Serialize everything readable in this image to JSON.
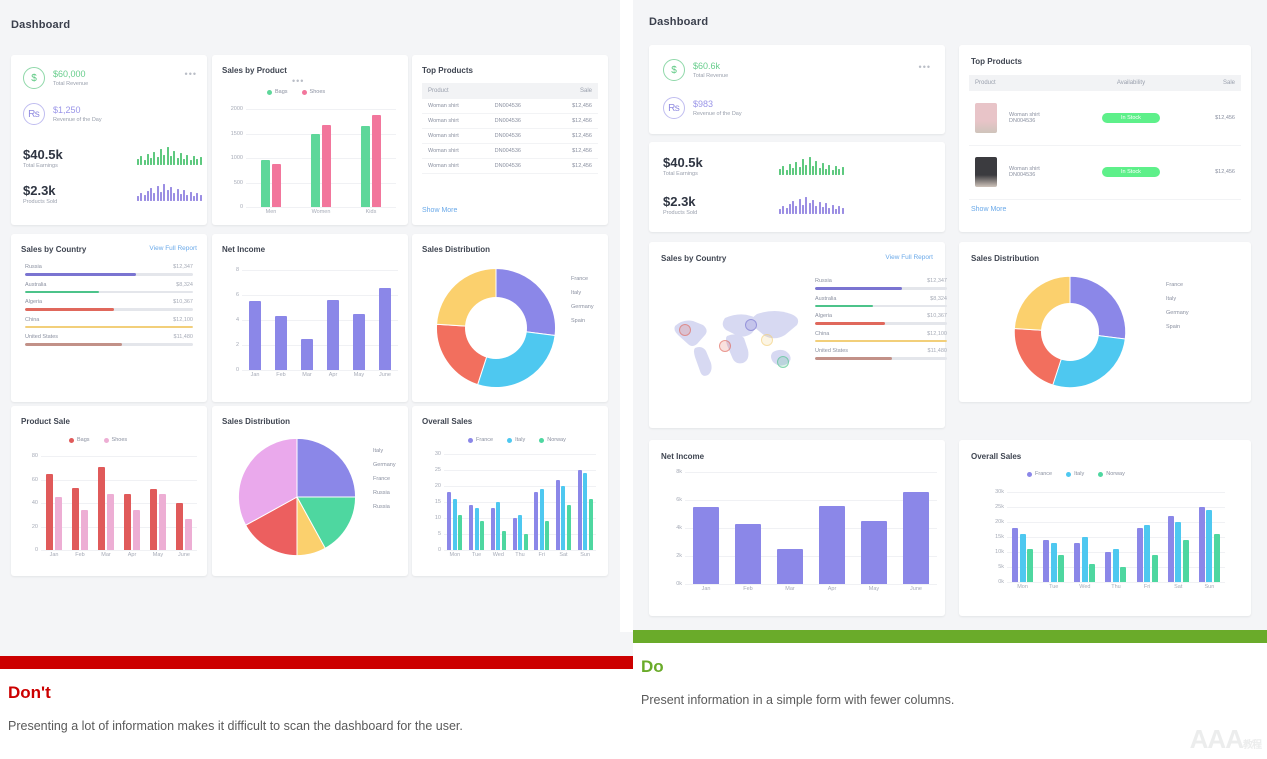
{
  "left": {
    "page_title": "Dashboard",
    "kpi": {
      "revenue_value": "$60,000",
      "revenue_label": "Total Revenue",
      "revenue_icon": "dollar-circle-icon",
      "day_value": "$1,250",
      "day_label": "Revenue of the Day",
      "day_icon": "rupee-circle-icon",
      "menu": "•••",
      "earnings_value": "$40.5k",
      "earnings_label": "Total Earnings",
      "sold_value": "$2.3k",
      "sold_label": "Products Sold",
      "earnings_spark": [
        6,
        9,
        5,
        11,
        7,
        13,
        8,
        16,
        10,
        18,
        9,
        14,
        7,
        12,
        6,
        10,
        5,
        9,
        6,
        8
      ],
      "sold_spark": [
        5,
        8,
        6,
        10,
        13,
        8,
        15,
        9,
        17,
        11,
        14,
        8,
        12,
        7,
        11,
        6,
        9,
        5,
        8,
        6
      ]
    },
    "sales_by_product": {
      "title": "Sales by Product",
      "menu": "•••",
      "legend": [
        {
          "label": "Bags",
          "color": "#5ed79a"
        },
        {
          "label": "Shoes",
          "color": "#f2769c"
        }
      ]
    },
    "top_products": {
      "title": "Top Products",
      "columns": [
        "Product",
        "Sale"
      ],
      "rows": [
        {
          "name": "Woman shirt",
          "sku": "DN004536",
          "sale": "$12,456"
        },
        {
          "name": "Woman shirt",
          "sku": "DN004536",
          "sale": "$12,456"
        },
        {
          "name": "Woman shirt",
          "sku": "DN004536",
          "sale": "$12,456"
        },
        {
          "name": "Woman shirt",
          "sku": "DN004536",
          "sale": "$12,456"
        },
        {
          "name": "Woman shirt",
          "sku": "DN004536",
          "sale": "$12,456"
        }
      ],
      "show_more": "Show More"
    },
    "sales_by_country": {
      "title": "Sales by Country",
      "action": "View Full Report"
    },
    "net_income": {
      "title": "Net Income"
    },
    "sales_distribution_donut": {
      "title": "Sales Distribution"
    },
    "product_sale": {
      "title": "Product Sale",
      "legend": [
        {
          "label": "Bags",
          "color": "#e05a5a"
        },
        {
          "label": "Shoes",
          "color": "#edaed4"
        }
      ]
    },
    "sales_distribution_pie": {
      "title": "Sales Distribution"
    },
    "overall_sales": {
      "title": "Overall Sales"
    }
  },
  "right": {
    "page_title": "Dashboard",
    "kpi": {
      "revenue_value": "$60.6k",
      "revenue_label": "Total Revenue",
      "revenue_icon": "dollar-circle-icon",
      "day_value": "$983",
      "day_label": "Revenue of the Day",
      "day_icon": "rupee-circle-icon",
      "menu": "•••",
      "earnings_value": "$40.5k",
      "earnings_label": "Total Earnings",
      "sold_value": "$2.3k",
      "sold_label": "Products Sold",
      "earnings_spark": [
        6,
        9,
        5,
        11,
        7,
        13,
        8,
        16,
        10,
        18,
        9,
        14,
        7,
        12,
        6,
        10,
        5,
        9,
        6,
        8
      ],
      "sold_spark": [
        5,
        8,
        6,
        10,
        13,
        8,
        15,
        9,
        17,
        11,
        14,
        8,
        12,
        7,
        11,
        6,
        9,
        5,
        8,
        6
      ]
    },
    "top_products": {
      "title": "Top Products",
      "columns": [
        "Product",
        "Availability",
        "Sale"
      ],
      "rows": [
        {
          "name": "Woman shirt",
          "sku": "DN004536",
          "availability": "In Stock",
          "sale": "$12,456"
        },
        {
          "name": "Woman shirt",
          "sku": "DN004536",
          "availability": "In Stock",
          "sale": "$12,456"
        }
      ],
      "show_more": "Show More"
    },
    "sales_by_country": {
      "title": "Sales by Country",
      "action": "View Full Report"
    },
    "sales_distribution_donut": {
      "title": "Sales Distribution"
    },
    "net_income": {
      "title": "Net Income"
    },
    "overall_sales": {
      "title": "Overall Sales"
    }
  },
  "countries": {
    "rows": [
      {
        "name": "Russia",
        "value": "$12,347",
        "pct": 66,
        "color": "#7a74d1"
      },
      {
        "name": "Australia",
        "value": "$8,324",
        "pct": 44,
        "color": "#4cc38a"
      },
      {
        "name": "Algeria",
        "value": "$10,367",
        "pct": 53,
        "color": "#e0685c"
      },
      {
        "name": "China",
        "value": "$12,100",
        "pct": 100,
        "color": "#f2cf7a"
      },
      {
        "name": "United States",
        "value": "$11,480",
        "pct": 58,
        "color": "#c29188"
      }
    ]
  },
  "banners": {
    "dont": {
      "title": "Don't",
      "text": "Presenting a lot of information makes it difficult to scan the dashboard for the user.",
      "color": "#cc0000"
    },
    "do": {
      "title": "Do",
      "text": "Present information in a simple form with fewer columns.",
      "color": "#6aab2a"
    },
    "watermark": "AAA",
    "watermark_sub": "教程"
  },
  "chart_data": [
    {
      "id": "sales-by-product",
      "type": "bar",
      "title": "Sales by Product",
      "categories": [
        "Men",
        "Women",
        "Kids"
      ],
      "series": [
        {
          "name": "Bags",
          "color": "#5ed79a",
          "values": [
            950,
            1490,
            1650
          ]
        },
        {
          "name": "Shoes",
          "color": "#f2769c",
          "values": [
            880,
            1680,
            1880
          ]
        }
      ],
      "yticks": [
        0,
        500,
        1000,
        1500,
        2000
      ],
      "ylim": [
        0,
        2000
      ],
      "grid": true,
      "legend": "top"
    },
    {
      "id": "net-income-left",
      "type": "bar",
      "title": "Net Income",
      "categories": [
        "Jan",
        "Feb",
        "Mar",
        "Apr",
        "May",
        "June"
      ],
      "series": [
        {
          "name": "Net Income",
          "color": "#8b87e8",
          "values": [
            5.5,
            4.3,
            2.5,
            5.6,
            4.5,
            6.6
          ]
        }
      ],
      "yticks": [
        0,
        2,
        4,
        6,
        8
      ],
      "ylim": [
        0,
        8
      ],
      "grid": true,
      "legend": "none"
    },
    {
      "id": "sales-distribution-donut",
      "type": "pie",
      "title": "Sales Distribution",
      "donut": true,
      "labels": [
        "France",
        "Italy",
        "Germany",
        "Spain"
      ],
      "values": [
        27,
        28,
        21,
        24
      ],
      "colors": [
        "#8b87e8",
        "#4ec8f0",
        "#f26f5e",
        "#fbd06d"
      ],
      "legend": "right"
    },
    {
      "id": "product-sale",
      "type": "bar",
      "title": "Product Sale",
      "categories": [
        "Jan",
        "Feb",
        "Mar",
        "Apr",
        "May",
        "June"
      ],
      "series": [
        {
          "name": "Bags",
          "color": "#e05a5a",
          "values": [
            65,
            53,
            71,
            48,
            52,
            40
          ]
        },
        {
          "name": "Shoes",
          "color": "#edaed4",
          "values": [
            45,
            34,
            48,
            34,
            48,
            26
          ]
        }
      ],
      "yticks": [
        0,
        20,
        40,
        60,
        80
      ],
      "ylim": [
        0,
        80
      ],
      "grid": true,
      "legend": "top"
    },
    {
      "id": "sales-distribution-pie",
      "type": "pie",
      "title": "Sales Distribution",
      "donut": false,
      "labels": [
        "Italy",
        "Germany",
        "France",
        "Russia",
        "Russia"
      ],
      "values": [
        25,
        17,
        8,
        17,
        33
      ],
      "colors": [
        "#8b87e8",
        "#4ed7a0",
        "#fbd06d",
        "#ec5f5f",
        "#eaa9ec"
      ],
      "legend": "right"
    },
    {
      "id": "overall-sales-left",
      "type": "bar",
      "title": "Overall Sales",
      "categories": [
        "Mon",
        "Tue",
        "Wed",
        "Thu",
        "Fri",
        "Sat",
        "Sun"
      ],
      "series": [
        {
          "name": "France",
          "color": "#8b87e8",
          "values": [
            18,
            14,
            13,
            10,
            18,
            22,
            25
          ]
        },
        {
          "name": "Italy",
          "color": "#4ec8f0",
          "values": [
            16,
            13,
            15,
            11,
            19,
            20,
            24
          ]
        },
        {
          "name": "Norway",
          "color": "#4ed7a0",
          "values": [
            11,
            9,
            6,
            5,
            9,
            14,
            16
          ]
        }
      ],
      "yticks": [
        0,
        5,
        10,
        15,
        20,
        25,
        30
      ],
      "ylim": [
        0,
        30
      ],
      "grid": true,
      "legend": "top"
    },
    {
      "id": "sales-distribution-donut-right",
      "type": "pie",
      "title": "Sales Distribution",
      "donut": true,
      "labels": [
        "France",
        "Italy",
        "Germany",
        "Spain"
      ],
      "values": [
        27,
        28,
        21,
        24
      ],
      "colors": [
        "#8b87e8",
        "#4ec8f0",
        "#f26f5e",
        "#fbd06d"
      ],
      "legend": "right"
    },
    {
      "id": "net-income-right",
      "type": "bar",
      "title": "Net Income",
      "categories": [
        "Jan",
        "Feb",
        "Mar",
        "Apr",
        "May",
        "June"
      ],
      "series": [
        {
          "name": "Net Income",
          "color": "#8b87e8",
          "values": [
            5.5,
            4.3,
            2.5,
            5.6,
            4.5,
            6.6
          ]
        }
      ],
      "yticks": [
        "0k",
        "2k",
        "4k",
        "6k",
        "8k"
      ],
      "ylim": [
        0,
        8
      ],
      "grid": true,
      "legend": "none"
    },
    {
      "id": "overall-sales-right",
      "type": "bar",
      "title": "Overall Sales",
      "categories": [
        "Mon",
        "Tue",
        "Wed",
        "Thu",
        "Fri",
        "Sat",
        "Sun"
      ],
      "series": [
        {
          "name": "France",
          "color": "#8b87e8",
          "values": [
            18,
            14,
            13,
            10,
            18,
            22,
            25
          ]
        },
        {
          "name": "Italy",
          "color": "#4ec8f0",
          "values": [
            16,
            13,
            15,
            11,
            19,
            20,
            24
          ]
        },
        {
          "name": "Norway",
          "color": "#4ed7a0",
          "values": [
            11,
            9,
            6,
            5,
            9,
            14,
            16
          ]
        }
      ],
      "yticks": [
        "0k",
        "5k",
        "10k",
        "15k",
        "20k",
        "25k",
        "30k"
      ],
      "ylim": [
        0,
        30
      ],
      "grid": true,
      "legend": "top"
    }
  ]
}
